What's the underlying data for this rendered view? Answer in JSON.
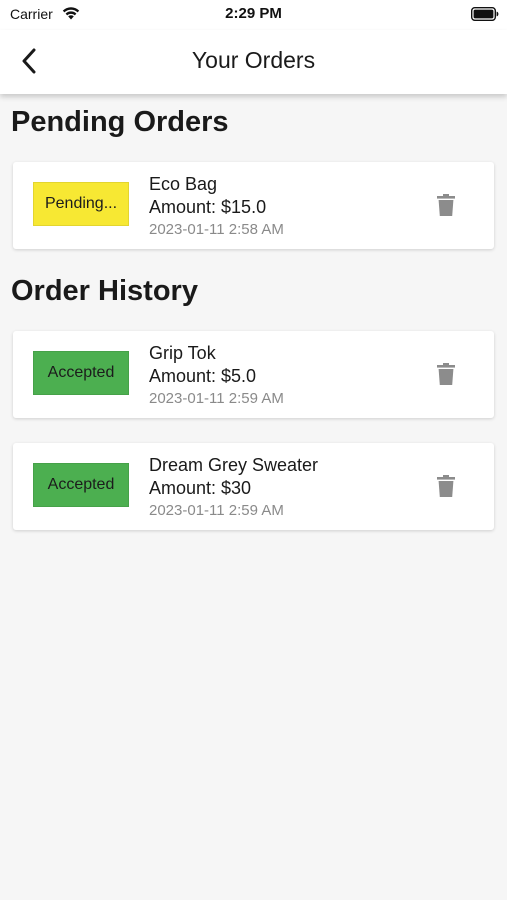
{
  "status_bar": {
    "carrier": "Carrier",
    "time": "2:29 PM"
  },
  "header": {
    "title": "Your Orders"
  },
  "pending_section": {
    "title": "Pending Orders",
    "orders": [
      {
        "status": "Pending...",
        "status_color": "#f7e833",
        "name": "Eco Bag",
        "amount": "Amount: $15.0",
        "date": "2023-01-11 2:58 AM"
      }
    ]
  },
  "history_section": {
    "title": "Order History",
    "orders": [
      {
        "status": "Accepted",
        "status_color": "#4caf50",
        "name": "Grip Tok",
        "amount": "Amount: $5.0",
        "date": "2023-01-11 2:59 AM"
      },
      {
        "status": "Accepted",
        "status_color": "#4caf50",
        "name": "Dream Grey Sweater",
        "amount": "Amount: $30",
        "date": "2023-01-11 2:59 AM"
      }
    ]
  },
  "icons": {
    "back": "chevron-left-icon",
    "delete": "trash-icon",
    "wifi": "wifi-icon",
    "battery": "battery-icon"
  },
  "colors": {
    "background": "#f6f6f6",
    "card": "#ffffff",
    "pending": "#f7e833",
    "accepted": "#4caf50",
    "icon_gray": "#8c8c8c"
  }
}
